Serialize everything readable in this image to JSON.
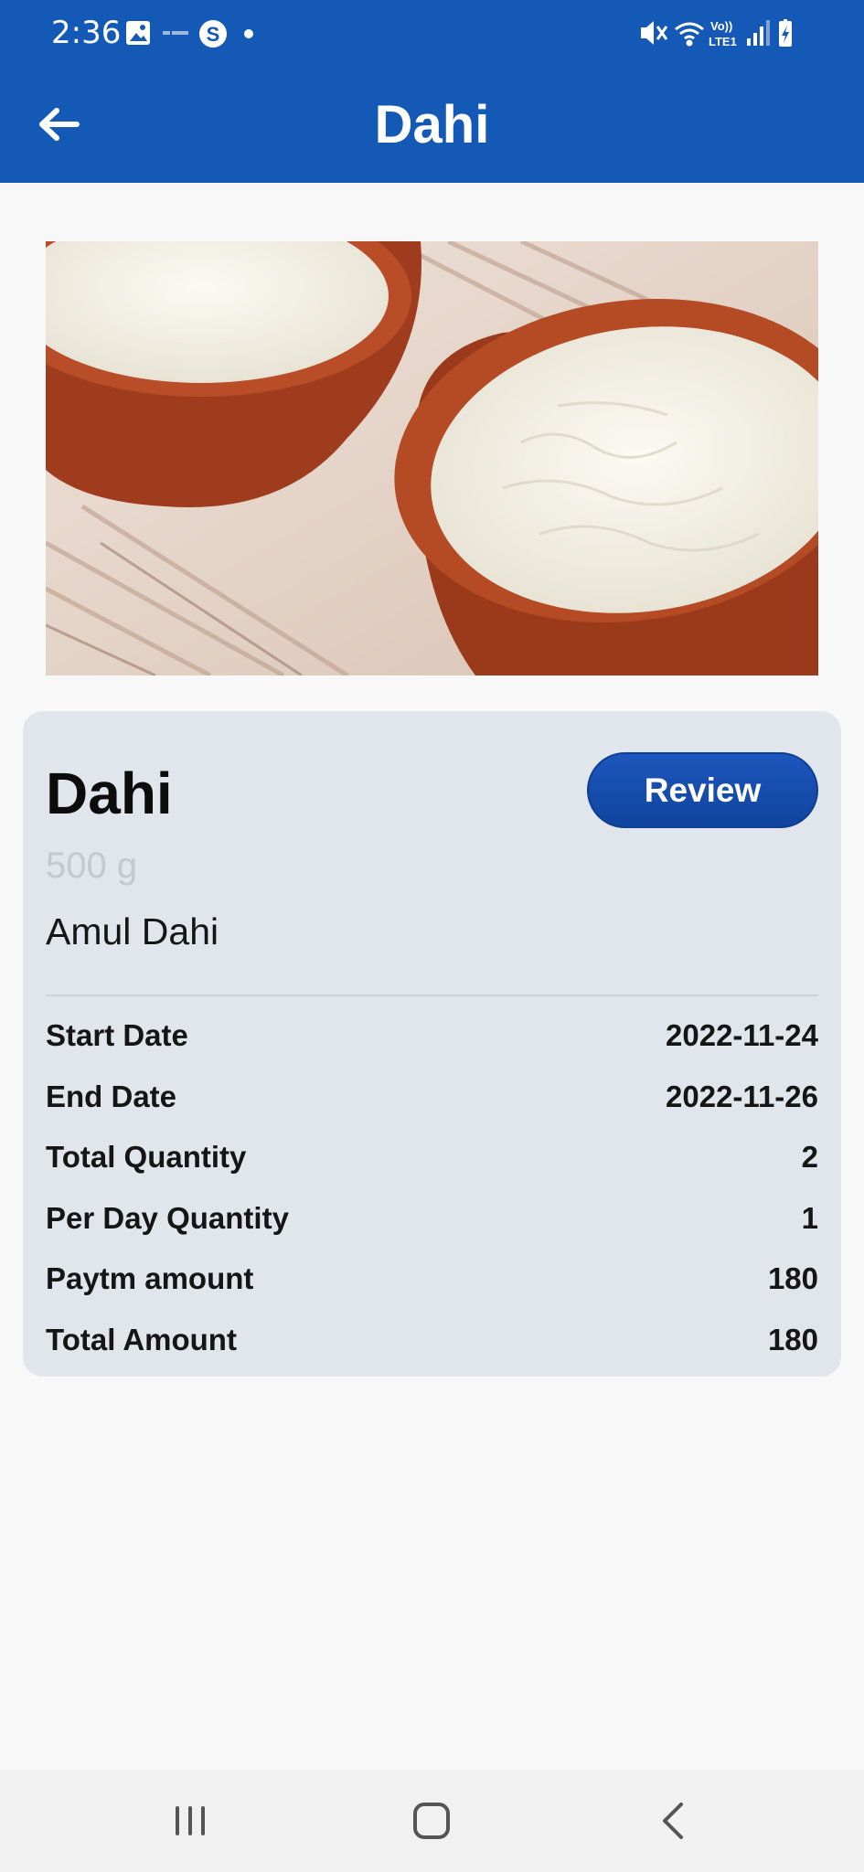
{
  "status_bar": {
    "time": "2:36",
    "left_icons": [
      "gallery-icon",
      "youtube-music-icon",
      "skype-icon",
      "dot-icon"
    ],
    "right_icons": [
      "mute-icon",
      "wifi-icon",
      "volte-lte1-icon",
      "signal-icon",
      "battery-icon"
    ],
    "volte_label": "Vo))",
    "lte_label": "LTE1"
  },
  "app_bar": {
    "title": "Dahi",
    "back_icon": "arrow-left-icon",
    "background_color": "#1459b5"
  },
  "product": {
    "name": "Dahi",
    "size": "500 g",
    "brand": "Amul Dahi",
    "review_label": "Review"
  },
  "details": [
    {
      "label": "Start Date",
      "value": "2022-11-24"
    },
    {
      "label": "End Date",
      "value": "2022-11-26"
    },
    {
      "label": "Total Quantity",
      "value": "2"
    },
    {
      "label": "Per Day Quantity",
      "value": "1"
    },
    {
      "label": "Paytm amount",
      "value": "180"
    },
    {
      "label": "Total Amount",
      "value": "180"
    }
  ],
  "nav_bar": {
    "icons": [
      "recent-apps-icon",
      "home-icon",
      "back-icon"
    ]
  }
}
